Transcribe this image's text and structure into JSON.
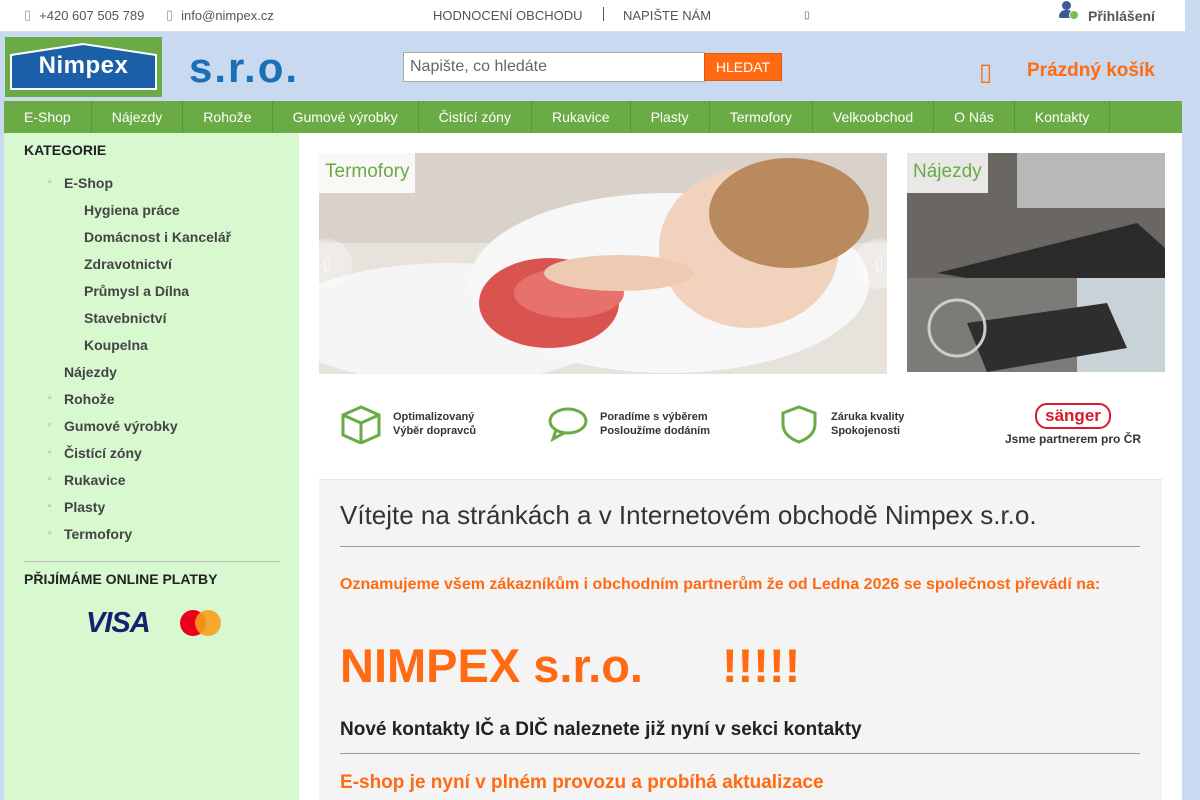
{
  "topbar": {
    "phone": "+420 607 505 789",
    "email": "info@nimpex.cz",
    "links": [
      "Hodnocení obchodu",
      "Napište nám"
    ],
    "login": "Přihlášení"
  },
  "header": {
    "logo": "Nimpex",
    "suffix": "s.r.o.",
    "search_placeholder": "Napište, co hledáte",
    "search_button": "HLEDAT",
    "cart": "Prázdný košík"
  },
  "nav": [
    "E-Shop",
    "Nájezdy",
    "Rohože",
    "Gumové výrobky",
    "Čistící zóny",
    "Rukavice",
    "Plasty",
    "Termofory",
    "Velkoobchod",
    "O Nás",
    "Kontakty"
  ],
  "sidebar": {
    "title": "KATEGORIE",
    "categories": [
      {
        "label": "E-Shop",
        "level": 0,
        "bullet": true
      },
      {
        "label": "Hygiena práce",
        "level": 1,
        "bullet": false
      },
      {
        "label": "Domácnost i Kancelář",
        "level": 1,
        "bullet": false
      },
      {
        "label": "Zdravotnictví",
        "level": 1,
        "bullet": false
      },
      {
        "label": "Průmysl a Dílna",
        "level": 1,
        "bullet": false
      },
      {
        "label": "Stavebnictví",
        "level": 1,
        "bullet": false
      },
      {
        "label": "Koupelna",
        "level": 1,
        "bullet": false
      },
      {
        "label": "Nájezdy",
        "level": 0,
        "bullet": false
      },
      {
        "label": "Rohože",
        "level": 0,
        "bullet": true
      },
      {
        "label": "Gumové výrobky",
        "level": 0,
        "bullet": true
      },
      {
        "label": "Čistící zóny",
        "level": 0,
        "bullet": true
      },
      {
        "label": "Rukavice",
        "level": 0,
        "bullet": true
      },
      {
        "label": "Plasty",
        "level": 0,
        "bullet": true
      },
      {
        "label": "Termofory",
        "level": 0,
        "bullet": true
      }
    ],
    "payments_title": "PŘIJÍMÁME ONLINE PLATBY",
    "visa": "VISA"
  },
  "banners": {
    "left": "Termofory",
    "right": "Nájezdy"
  },
  "features": [
    {
      "line1": "Optimalizovaný",
      "line2": "Výběr dopravců"
    },
    {
      "line1": "Poradíme s výběrem",
      "line2": "Posloužíme dodáním"
    },
    {
      "line1": "Záruka kvality",
      "line2": "Spokojenosti"
    },
    {
      "brand": "sänger",
      "line2": "Jsme partnerem pro ČR"
    }
  ],
  "welcome": {
    "title": "Vítejte na stránkách a v Internetovém obchodě Nimpex s.r.o.",
    "announce": "Oznamujeme všem zákazníkům i obchodním partnerům že od Ledna 2026 se společnost převádí na:",
    "big_name": "NIMPEX s.r.o.",
    "big_exclaim": "!!!!!",
    "contacts": "Nové kontakty IČ a DIČ naleznete již nyní v sekci kontakty",
    "eshop": "E-shop je nyní v plném provozu a probíhá aktualizace"
  },
  "colors": {
    "accent": "#ff6a13",
    "nav": "#6aab46",
    "sidebar": "#d8f8d0",
    "brand_blue": "#1b6fb7"
  }
}
